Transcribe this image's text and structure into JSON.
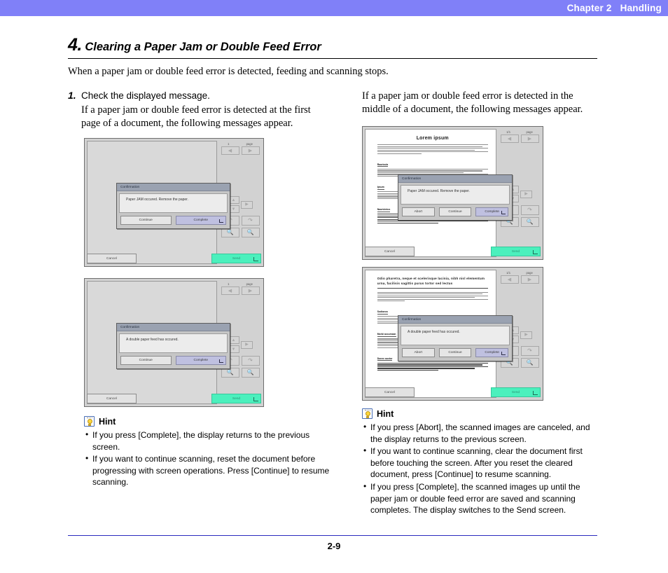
{
  "header": {
    "chapter": "Chapter 2",
    "section": "Handling"
  },
  "title": {
    "number": "4.",
    "name": "Clearing a Paper Jam or Double Feed Error"
  },
  "intro": "When a paper jam or double feed error is detected, feeding and scanning stops.",
  "left_column": {
    "step_number": "1.",
    "step_title": "Check the displayed message.",
    "step_text": "If a paper jam or double feed error is detected at the first page of a document, the following messages appear.",
    "screens": [
      {
        "page_indicator": "1",
        "page_label": "page",
        "cancel_label": "Cancel",
        "send_label": "Send",
        "dialog": {
          "title": "Confirmation",
          "message": "Paper JAM occured. Remove the paper.",
          "buttons": [
            "Continue",
            "Complete"
          ]
        }
      },
      {
        "page_indicator": "1",
        "page_label": "page",
        "cancel_label": "Cancel",
        "send_label": "Send",
        "dialog": {
          "title": "Confirmation",
          "message": "A double paper feed has occured.",
          "buttons": [
            "Continue",
            "Complete"
          ]
        }
      }
    ],
    "hint": {
      "label": "Hint",
      "items": [
        "If you press [Complete], the display returns to the previous screen.",
        "If you want to continue scanning, reset the document before progressing with screen operations. Press [Continue] to resume scanning."
      ]
    }
  },
  "right_column": {
    "intro": "If a paper jam or double feed error is detected in the middle of a document, the following messages appear.",
    "screens": [
      {
        "page_indicator": "1/1",
        "page_label": "page",
        "cancel_label": "Cancel",
        "send_label": "Send",
        "document_title": "Lorem ipsum",
        "dialog": {
          "title": "Confirmation",
          "message": "Paper JAM occured. Remove the paper.",
          "buttons": [
            "Abort",
            "Continue",
            "Complete"
          ]
        }
      },
      {
        "page_indicator": "1/1",
        "page_label": "page",
        "cancel_label": "Cancel",
        "send_label": "Send",
        "document_title": "Odio pharetra, neque et scelerisque lacinia, nibh nisl elementum urna, facilisis sagittis purus tortor sed lectus",
        "dialog": {
          "title": "Confirmation",
          "message": "A double paper feed has occured.",
          "buttons": [
            "Abort",
            "Continue",
            "Complete"
          ]
        }
      }
    ],
    "hint": {
      "label": "Hint",
      "items": [
        "If you press [Abort], the scanned images are canceled, and the display returns to the previous screen.",
        "If you want to continue scanning, clear the document first before touching the screen. After you reset the cleared document, press [Continue] to resume scanning.",
        "If you press [Complete], the scanned images up until the paper jam or double feed error are saved and scanning completes. The display switches to the Send screen."
      ]
    }
  },
  "footer": {
    "page_number": "2-9"
  },
  "colors": {
    "header_band": "#8080f8",
    "footer_rule": "#2b2bbf",
    "send_button": "#4bf0bd",
    "primary_button": "#bfc0e0",
    "dialog_titlebar": "#9aa2b1"
  }
}
